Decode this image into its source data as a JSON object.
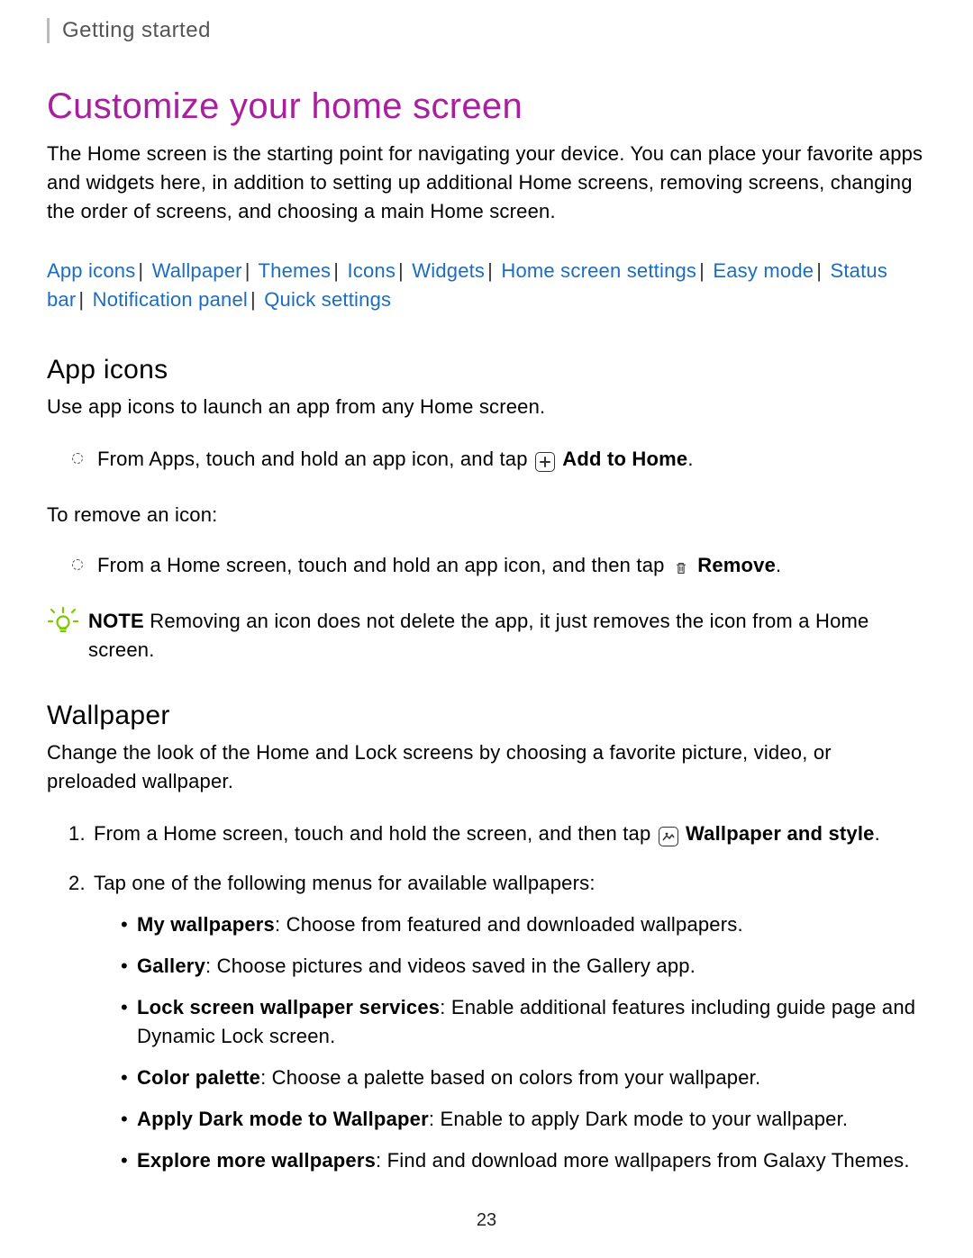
{
  "breadcrumb": "Getting started",
  "title": "Customize your home screen",
  "intro": "The Home screen is the starting point for navigating your device. You can place your favorite apps and widgets here, in addition to setting up additional Home screens, removing screens, changing the order of screens, and choosing a main Home screen.",
  "toc": {
    "items": [
      "App icons",
      "Wallpaper",
      "Themes",
      "Icons",
      "Widgets",
      "Home screen settings",
      "Easy mode",
      "Status bar",
      "Notification panel",
      "Quick settings"
    ]
  },
  "sections": {
    "appIcons": {
      "heading": "App icons",
      "intro": "Use app icons to launch an app from any Home screen.",
      "step1_pre": "From Apps, touch and hold an app icon, and tap ",
      "step1_bold": "Add to Home",
      "removeIntro": "To remove an icon:",
      "step2_pre": "From a Home screen, touch and hold an app icon, and then tap ",
      "step2_bold": "Remove",
      "note_label": "NOTE",
      "note_text": " Removing an icon does not delete the app, it just removes the icon from a Home screen."
    },
    "wallpaper": {
      "heading": "Wallpaper",
      "intro": "Change the look of the Home and Lock screens by choosing a favorite picture, video, or preloaded wallpaper.",
      "step1_pre": "From a Home screen, touch and hold the screen, and then tap ",
      "step1_bold": "Wallpaper and style",
      "step2": "Tap one of the following menus for available wallpapers:",
      "bullets": [
        {
          "bold": "My wallpapers",
          "rest": ": Choose from featured and downloaded wallpapers."
        },
        {
          "bold": "Gallery",
          "rest": ": Choose pictures and videos saved in the Gallery app."
        },
        {
          "bold": "Lock screen wallpaper services",
          "rest": ": Enable additional features including guide page and Dynamic Lock screen."
        },
        {
          "bold": "Color palette",
          "rest": ": Choose a palette based on colors from your wallpaper."
        },
        {
          "bold": "Apply Dark mode to Wallpaper",
          "rest": ": Enable to apply Dark mode to your wallpaper."
        },
        {
          "bold": "Explore more wallpapers",
          "rest": ": Find and download more wallpapers from Galaxy Themes."
        }
      ]
    }
  },
  "pageNumber": "23"
}
